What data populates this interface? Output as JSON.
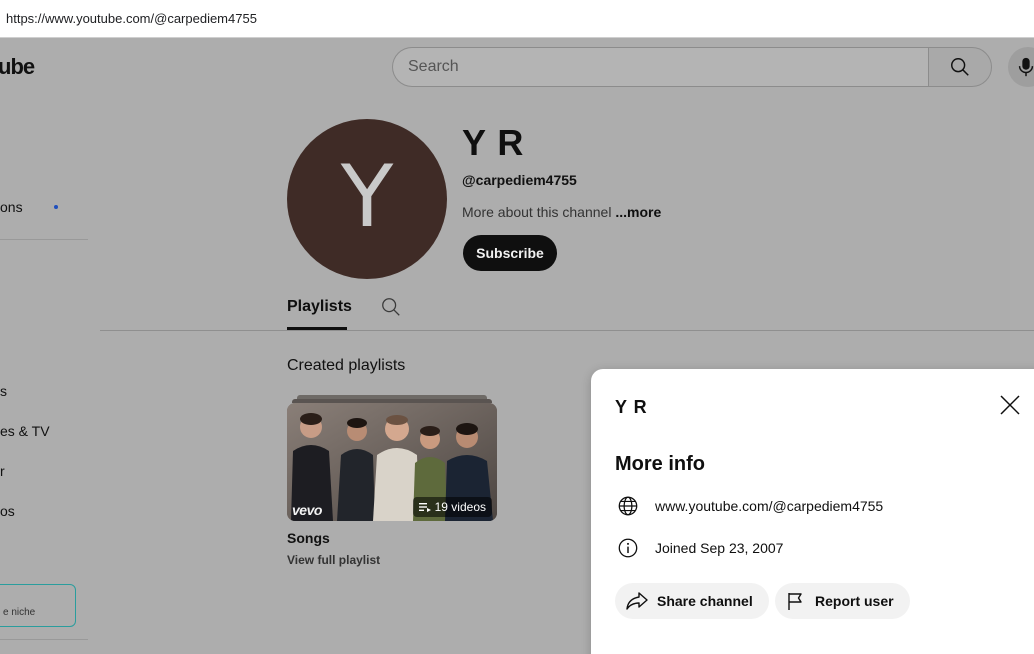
{
  "browser": {
    "url": "https://www.youtube.com/@carpediem4755"
  },
  "header": {
    "logo_fragment": "ube",
    "search_placeholder": "Search"
  },
  "sidebar": {
    "items": [
      {
        "label": "ons"
      },
      {
        "label": "s"
      },
      {
        "label": "es & TV"
      },
      {
        "label": "r"
      },
      {
        "label": "os"
      }
    ],
    "promo_text": "e niche"
  },
  "channel": {
    "avatar_letter": "Y",
    "name": "Y R",
    "handle": "@carpediem4755",
    "about_text": "More about this channel",
    "more_label": "...more",
    "subscribe_label": "Subscribe"
  },
  "tabs": {
    "active": "Playlists"
  },
  "playlists_section": {
    "title": "Created playlists",
    "items": [
      {
        "title": "Songs",
        "link_label": "View full playlist",
        "count_label": "19 videos",
        "brand": "vevo"
      }
    ]
  },
  "modal": {
    "channel_name": "Y R",
    "heading": "More info",
    "url_row": "www.youtube.com/@carpediem4755",
    "joined_row": "Joined Sep 23, 2007",
    "share_label": "Share channel",
    "report_label": "Report user"
  },
  "icons": {
    "search": "search-icon",
    "mic": "mic-icon",
    "close": "close-icon",
    "globe": "globe-icon",
    "info": "info-icon",
    "share": "share-icon",
    "flag": "flag-icon",
    "playlist": "playlist-icon"
  },
  "colors": {
    "overlay_background": "#adadad",
    "avatar": "#3f2b26",
    "subscribe_button": "#0f0f0f",
    "modal_background": "#ffffff"
  }
}
